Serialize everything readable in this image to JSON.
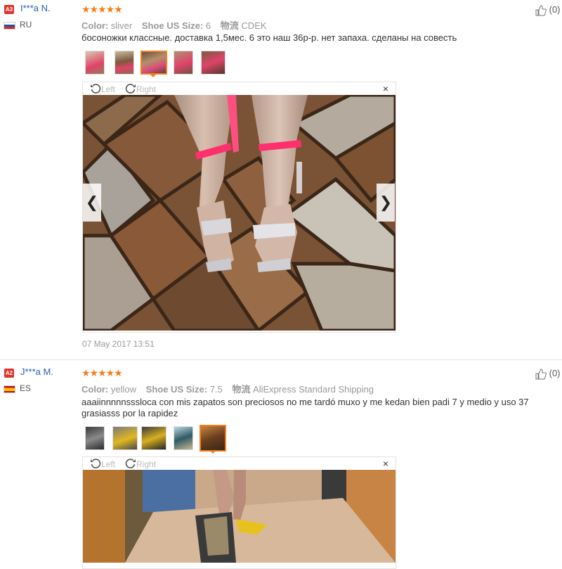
{
  "reviews": [
    {
      "level": "A3",
      "user": "I***a N.",
      "country": "RU",
      "stars": "★★★★★",
      "likes": "(0)",
      "color_label": "Color:",
      "color_value": "sliver",
      "size_label": "Shoe US Size:",
      "size_value": "6",
      "shipping_label": "物流",
      "shipping_value": "CDEK",
      "text": "босоножки классные. доставка 1,5мес. 6 это наш 36р-р. нет запаха. сделаны на совесть",
      "date": "07 May 2017 13:51",
      "viewer": {
        "left_label": "Left",
        "right_label": "Right",
        "close": "×",
        "prev": "❮",
        "next": "❯"
      }
    },
    {
      "level": "A2",
      "user": "J***a M.",
      "country": "ES",
      "stars": "★★★★★",
      "likes": "(0)",
      "color_label": "Color:",
      "color_value": "yellow",
      "size_label": "Shoe US Size:",
      "size_value": "7.5",
      "shipping_label": "物流",
      "shipping_value": "AliExpress Standard Shipping",
      "text": "aaaiinnnnnsssloca con mis zapatos son preciosos no me tardó muxo y me kedan bien padi 7 y medio y uso 37 grasiasss por la rapidez",
      "viewer": {
        "left_label": "Left",
        "right_label": "Right",
        "close": "×"
      }
    }
  ],
  "colors": {
    "accent": "#f27f1c",
    "username": "#2a5bb7",
    "level_badge": "#e0322b"
  }
}
